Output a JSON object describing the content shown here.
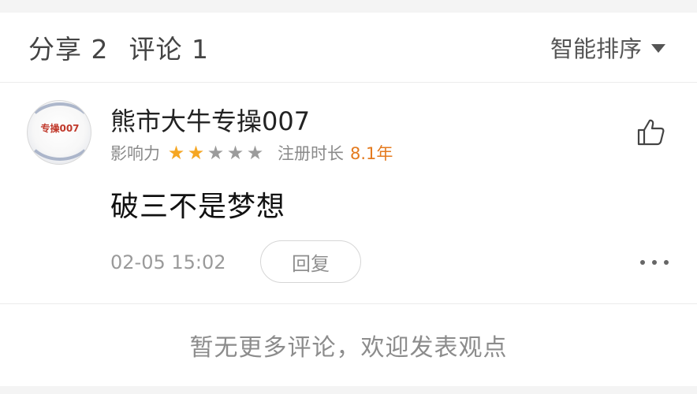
{
  "header": {
    "share_tab": "分享 2",
    "comment_tab": "评论 1",
    "sort_label": "智能排序"
  },
  "comment": {
    "avatar_text": "专操007",
    "username": "熊市大牛专操007",
    "influence_label": "影响力",
    "rating": 2,
    "rating_max": 5,
    "registration_label": "注册时长",
    "registration_value": "8.1年",
    "content": "破三不是梦想",
    "timestamp": "02-05 15:02",
    "reply_label": "回复",
    "icons": [
      "thumbs-up-icon",
      "more-icon",
      "caret-down-icon"
    ]
  },
  "footer": {
    "text": "暂无更多评论，欢迎发表观点"
  },
  "colors": {
    "star_on": "#f5a623",
    "star_off": "#9b9b9b",
    "registration_value": "#e47a1e"
  }
}
